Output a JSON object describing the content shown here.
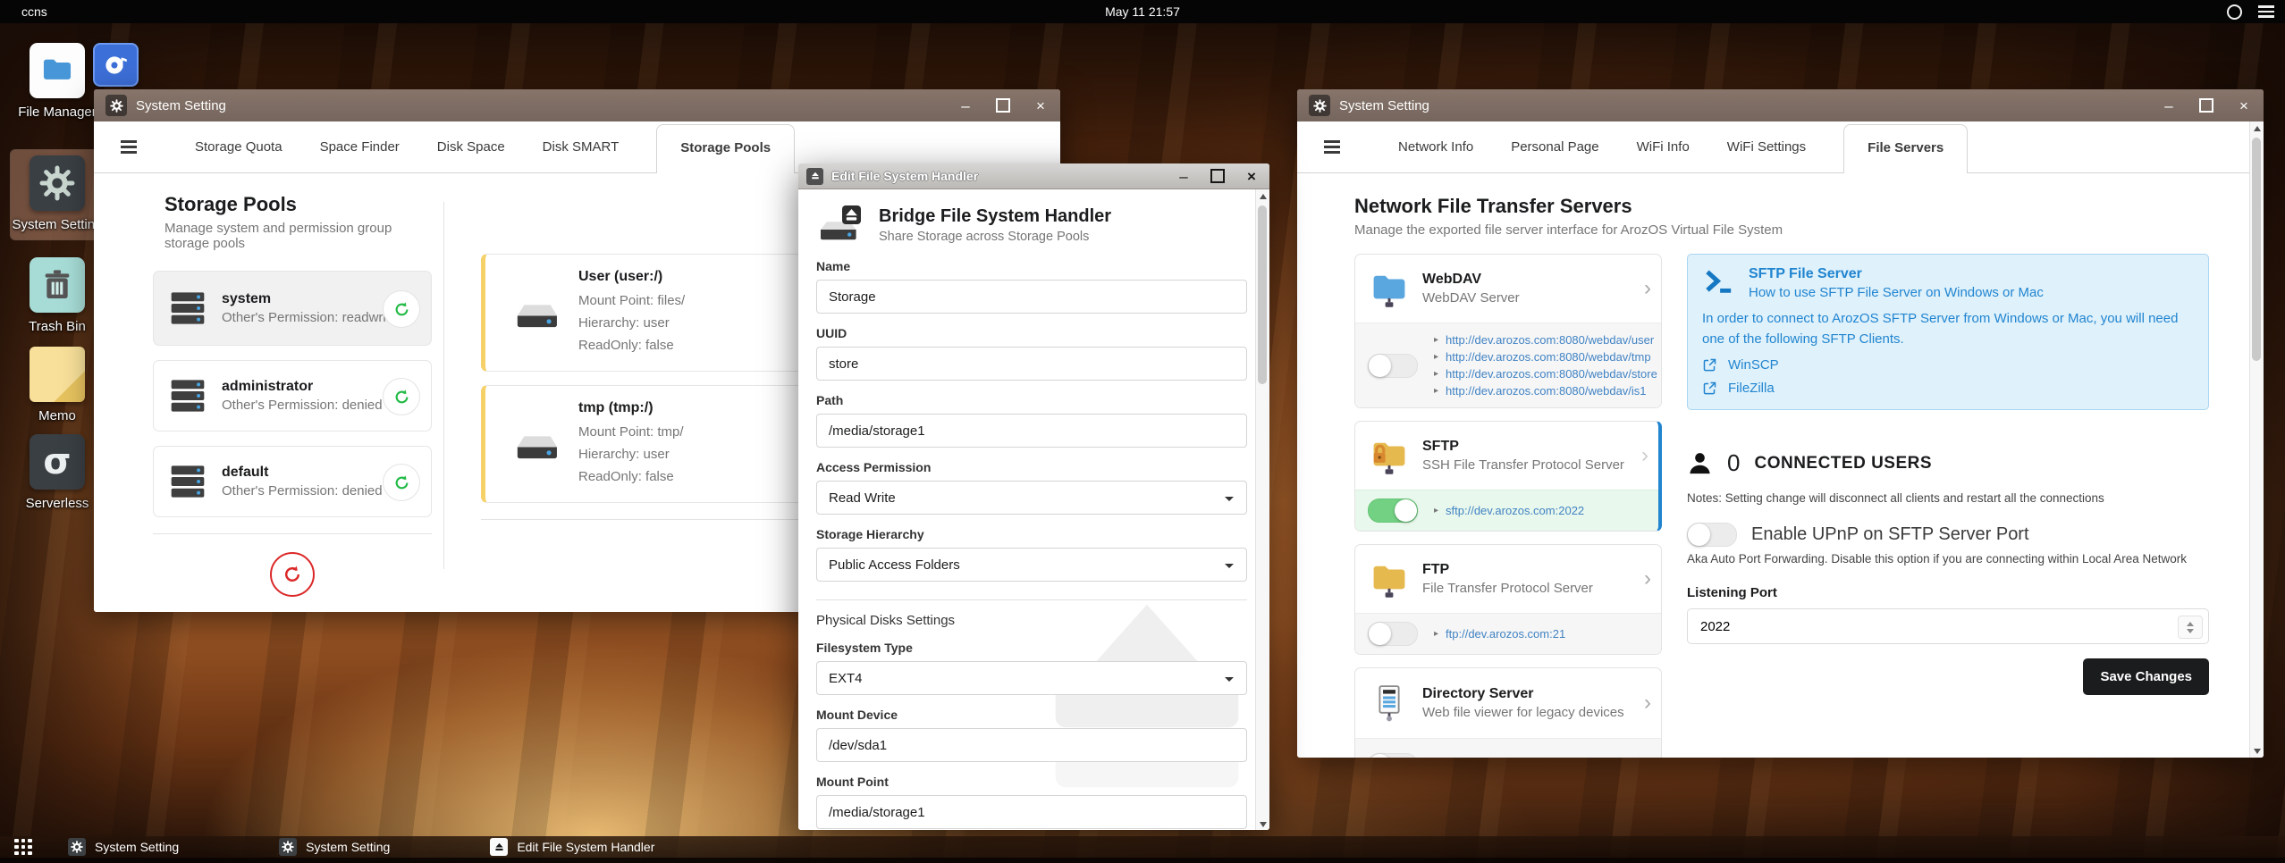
{
  "topbar": {
    "host": "ccns",
    "clock": "May 11 21:57"
  },
  "window_controls": {
    "minimize": "–",
    "close": "×"
  },
  "glyphs": {
    "chevron": "›",
    "link_bullet": "▸",
    "plus": "+"
  },
  "desktop": {
    "icons": [
      {
        "label": "File Manager"
      },
      {
        "label": "System Setting"
      },
      {
        "label": "Trash Bin"
      },
      {
        "label": "Memo"
      },
      {
        "label": "Serverless"
      }
    ]
  },
  "storage_window": {
    "title": "System Setting",
    "tabs": [
      {
        "label": "Storage Quota"
      },
      {
        "label": "Space Finder"
      },
      {
        "label": "Disk Space"
      },
      {
        "label": "Disk SMART"
      },
      {
        "label": "Storage Pools"
      }
    ],
    "heading": "Storage Pools",
    "subheading": "Manage system and permission group storage pools",
    "pools": [
      {
        "name": "system",
        "permission": "Other's Permission: readwrite"
      },
      {
        "name": "administrator",
        "permission": "Other's Permission: denied"
      },
      {
        "name": "default",
        "permission": "Other's Permission: denied"
      }
    ],
    "handlers": [
      {
        "title": "User (user:/)",
        "mount_point": "Mount Point: files/",
        "hierarchy": "Hierarchy: user",
        "readonly": "ReadOnly: false"
      },
      {
        "title": "tmp (tmp:/)",
        "mount_point": "Mount Point: tmp/",
        "hierarchy": "Hierarchy: user",
        "readonly": "ReadOnly: false"
      }
    ]
  },
  "edit_dialog": {
    "title": "Edit File System Handler",
    "heading": "Bridge File System Handler",
    "subheading": "Share Storage across Storage Pools",
    "name_label": "Name",
    "name_value": "Storage",
    "uuid_label": "UUID",
    "uuid_value": "store",
    "path_label": "Path",
    "path_value": "/media/storage1",
    "access_label": "Access Permission",
    "access_value": "Read Write",
    "hierarchy_label": "Storage Hierarchy",
    "hierarchy_value": "Public Access Folders",
    "disks_section": "Physical Disks Settings",
    "fstype_label": "Filesystem Type",
    "fstype_value": "EXT4",
    "mount_device_label": "Mount Device",
    "mount_device_value": "/dev/sda1",
    "mount_point_label": "Mount Point",
    "mount_point_value": "/media/storage1"
  },
  "network_window": {
    "title": "System Setting",
    "tabs": [
      {
        "label": "Network Info"
      },
      {
        "label": "Personal Page"
      },
      {
        "label": "WiFi Info"
      },
      {
        "label": "WiFi Settings"
      },
      {
        "label": "File Servers"
      }
    ],
    "heading": "Network File Transfer Servers",
    "subheading": "Manage the exported file server interface for ArozOS Virtual File System",
    "webdav": {
      "name": "WebDAV",
      "desc": "WebDAV Server",
      "links": [
        "http://dev.arozos.com:8080/webdav/user",
        "http://dev.arozos.com:8080/webdav/tmp",
        "http://dev.arozos.com:8080/webdav/store",
        "http://dev.arozos.com:8080/webdav/is1"
      ]
    },
    "sftp": {
      "name": "SFTP",
      "desc": "SSH File Transfer Protocol Server",
      "link": "sftp://dev.arozos.com:2022"
    },
    "ftp": {
      "name": "FTP",
      "desc": "File Transfer Protocol Server",
      "link": "ftp://dev.arozos.com:21"
    },
    "directory": {
      "name": "Directory Server",
      "desc": "Web file viewer for legacy devices"
    },
    "sftp_info": {
      "title": "SFTP File Server",
      "subtitle": "How to use SFTP File Server on Windows or Mac",
      "body": "In order to connect to ArozOS SFTP Server from Windows or Mac, you will need one of the following SFTP Clients.",
      "clients": [
        {
          "label": "WinSCP"
        },
        {
          "label": "FileZilla"
        }
      ]
    },
    "connected_users": {
      "count": "0",
      "label": "CONNECTED USERS",
      "note": "Notes: Setting change will disconnect all clients and restart all the connections"
    },
    "upnp": {
      "label": "Enable UPnP on SFTP Server Port",
      "desc": "Aka Auto Port Forwarding. Disable this option if you are connecting within Local Area Network"
    },
    "listening_port": {
      "label": "Listening Port",
      "value": "2022"
    },
    "save_label": "Save Changes"
  },
  "taskbar": {
    "items": [
      {
        "label": "System Setting"
      },
      {
        "label": "System Setting"
      },
      {
        "label": "Edit File System Handler"
      }
    ]
  },
  "colors": {
    "accent_blue": "#2185d0",
    "link_blue": "#4183c4",
    "toggle_on_green": "#73d183",
    "sync_green": "#21ba45",
    "refresh_red": "#db2828",
    "handler_accent_yellow": "#f6d168",
    "info_box_bg": "#dff1fb",
    "save_button_bg": "#1b1c1d"
  }
}
